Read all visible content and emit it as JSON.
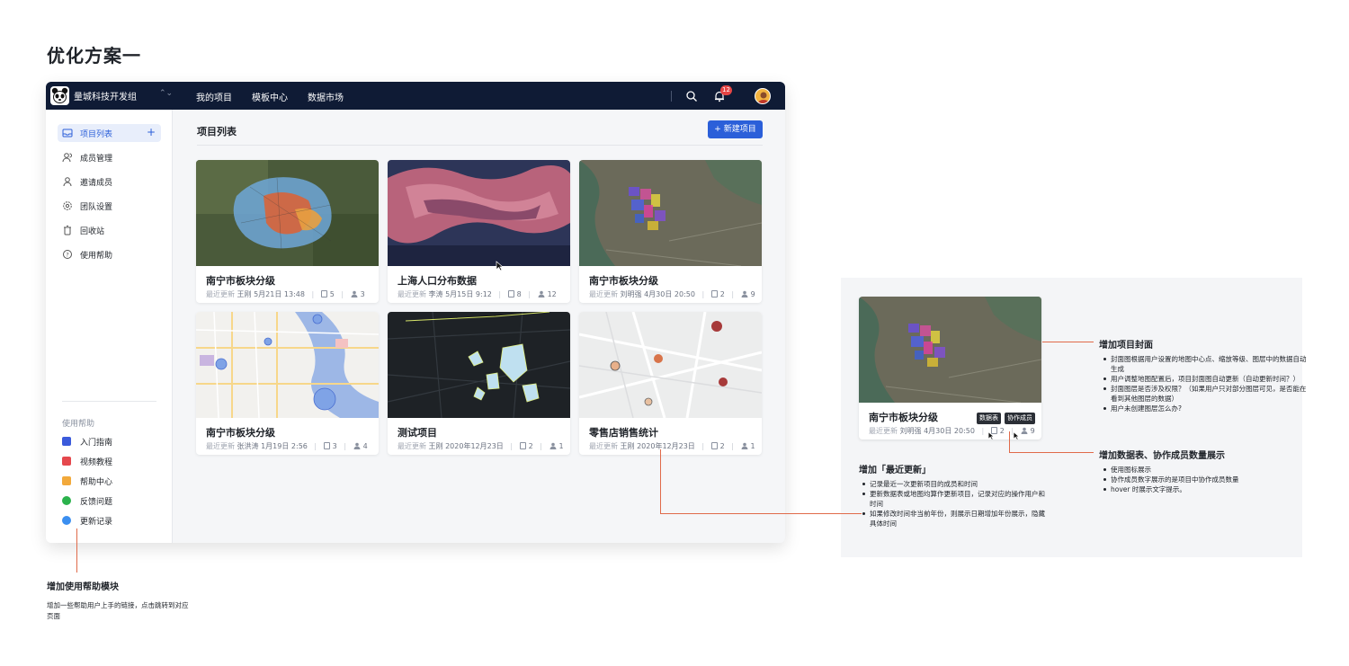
{
  "page_heading": "优化方案一",
  "topbar": {
    "team_name": "量城科技开发组",
    "team_switch": "⌃⌄",
    "nav": [
      {
        "label": "我的项目"
      },
      {
        "label": "模板中心"
      },
      {
        "label": "数据市场"
      }
    ],
    "notification_count": "12"
  },
  "sidebar": {
    "items": [
      {
        "label": "项目列表",
        "icon": "inbox-icon"
      },
      {
        "label": "成员管理",
        "icon": "users-icon"
      },
      {
        "label": "邀请成员",
        "icon": "user-add-icon"
      },
      {
        "label": "团队设置",
        "icon": "gear-icon"
      },
      {
        "label": "回收站",
        "icon": "trash-icon"
      },
      {
        "label": "使用帮助",
        "icon": "help-icon"
      }
    ],
    "add_symbol": "+",
    "help_title": "使用帮助",
    "help_items": [
      {
        "label": "入门指南",
        "icon": "book-icon",
        "color": "#3b5bdb"
      },
      {
        "label": "视频教程",
        "icon": "video-icon",
        "color": "#e5484d"
      },
      {
        "label": "帮助中心",
        "icon": "map-icon",
        "color": "#f2a93b"
      },
      {
        "label": "反馈问题",
        "icon": "wechat-icon",
        "color": "#2bb24c"
      },
      {
        "label": "更新记录",
        "icon": "compass-icon",
        "color": "#3b8ff0"
      }
    ]
  },
  "main": {
    "title": "项目列表",
    "new_button": "新建项目",
    "new_button_icon": "+",
    "meta_label": "最近更新",
    "cards": [
      {
        "title": "南宁市板块分级",
        "user": "王刚",
        "time": "5月21日 13:48",
        "tables": "5",
        "members": "3",
        "cover": "satellite-blocks"
      },
      {
        "title": "上海人口分布数据",
        "user": "李涛",
        "time": "5月15日 9:12",
        "tables": "8",
        "members": "12",
        "cover": "clouds"
      },
      {
        "title": "南宁市板块分级",
        "user": "刘明强",
        "time": "4月30日 20:50",
        "tables": "2",
        "members": "9",
        "cover": "satellite-river"
      },
      {
        "title": "南宁市板块分级",
        "user": "张洪涛",
        "time": "1月19日 2:56",
        "tables": "3",
        "members": "4",
        "cover": "street-map"
      },
      {
        "title": "测试项目",
        "user": "王刚",
        "time": "2020年12月23日",
        "tables": "2",
        "members": "1",
        "cover": "dark-map"
      },
      {
        "title": "零售店销售统计",
        "user": "王刚",
        "time": "2020年12月23日",
        "tables": "2",
        "members": "1",
        "cover": "light-map"
      }
    ]
  },
  "annotation": {
    "card": {
      "title": "南宁市板块分级",
      "meta_label": "最近更新",
      "user": "刘明强",
      "time": "4月30日 20:50",
      "tables": "2",
      "members": "9"
    },
    "tooltip_tables": "数据表",
    "tooltip_members": "协作成员",
    "cover_note": {
      "title": "增加项目封面",
      "items": [
        "封面图根据用户设置的地图中心点、缩放等级、图层中的数据自动生成",
        "用户调整地图配置后，项目封面图自动更新（自动更新时间？）",
        "封面图层是否涉及权限？（如果用户只对部分图层可见，是否能在看到其他图层的数据）",
        "用户未创建图层怎么办?"
      ]
    },
    "count_note": {
      "title": "增加数据表、协作成员数量展示",
      "items": [
        "使用图标展示",
        "协作成员数字展示的是项目中协作成员数量",
        "hover 时展示文字提示。"
      ]
    },
    "update_note": {
      "title": "增加「最近更新」",
      "items": [
        "记录最近一次更新项目的成员和时间",
        "更新数据表或地图均算作更新项目，记录对应的操作用户和时间",
        "如果修改时间非当前年份，则展示日期增加年份展示，隐藏具体时间"
      ]
    }
  },
  "help_note": {
    "title": "增加使用帮助模块",
    "text": "增加一些帮助用户上手的链接，点击跳转到对应页面"
  },
  "colors": {
    "accent": "#2b5fd9",
    "topbar": "#0f1b35",
    "annotation_line": "#e06a4a"
  }
}
